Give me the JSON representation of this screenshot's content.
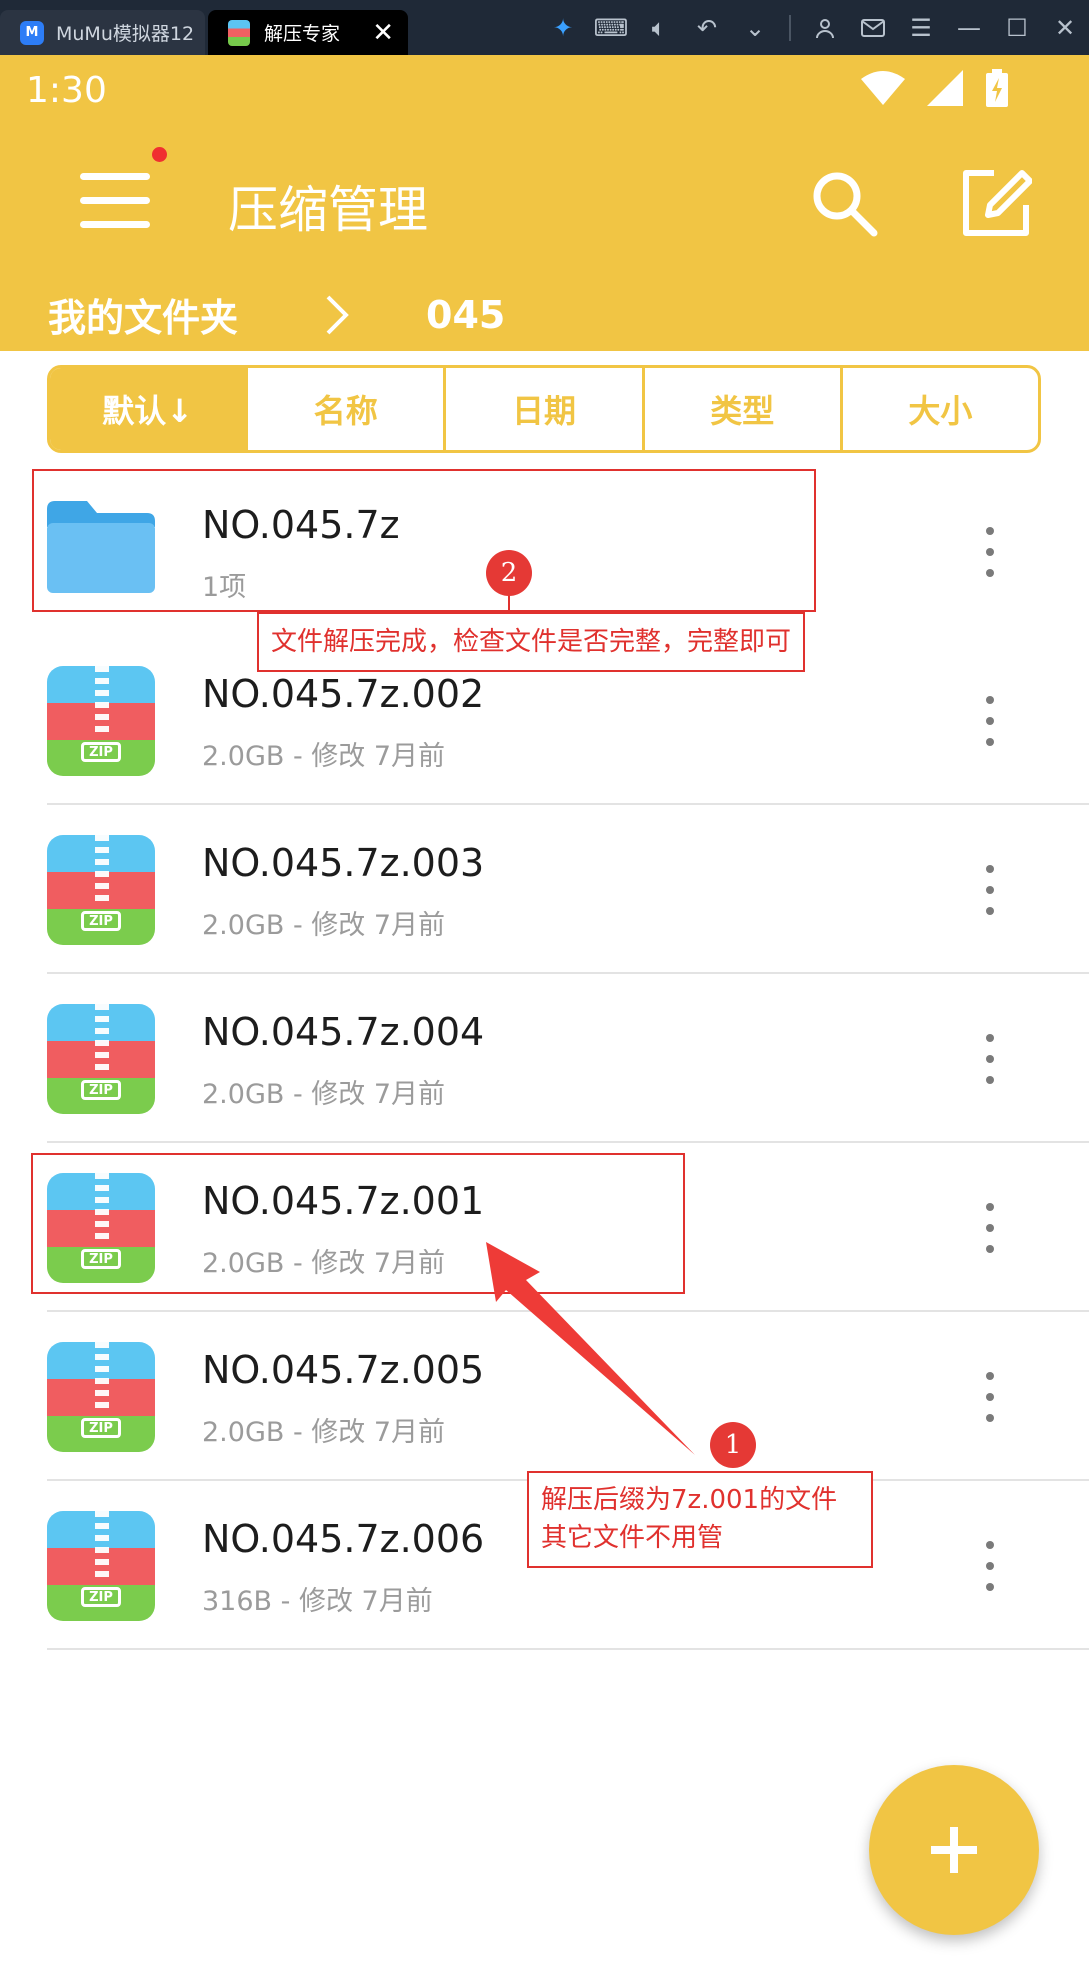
{
  "emulator": {
    "tabs": [
      {
        "label": "MuMu模拟器12"
      },
      {
        "label": "解压专家"
      }
    ],
    "mumu_logo": "M"
  },
  "status_bar": {
    "time": "1:30"
  },
  "header": {
    "title": "压缩管理",
    "breadcrumb": {
      "root": "我的文件夹",
      "current": "045"
    }
  },
  "sort_tabs": [
    "默认↓",
    "名称",
    "日期",
    "类型",
    "大小"
  ],
  "files": [
    {
      "name": "NO.045.7z",
      "meta": "1项",
      "icon": "folder-icon"
    },
    {
      "name": "NO.045.7z.002",
      "meta": "2.0GB - 修改 7月前",
      "icon": "zip-icon"
    },
    {
      "name": "NO.045.7z.003",
      "meta": "2.0GB - 修改 7月前",
      "icon": "zip-icon"
    },
    {
      "name": "NO.045.7z.004",
      "meta": "2.0GB - 修改 7月前",
      "icon": "zip-icon"
    },
    {
      "name": "NO.045.7z.001",
      "meta": "2.0GB - 修改 7月前",
      "icon": "zip-icon"
    },
    {
      "name": "NO.045.7z.005",
      "meta": "2.0GB - 修改 7月前",
      "icon": "zip-icon"
    },
    {
      "name": "NO.045.7z.006",
      "meta": "316B - 修改 7月前",
      "icon": "zip-icon"
    }
  ],
  "zip_tag": "ZIP",
  "annotations": {
    "note1": {
      "number": "1",
      "lines": [
        "解压后缀为7z.001的文件",
        "其它文件不用管"
      ]
    },
    "note2": {
      "number": "2",
      "text": "文件解压完成，检查文件是否完整，完整即可"
    }
  },
  "fab": {
    "label": "+"
  },
  "colors": {
    "accent": "#f1c544",
    "annotation": "#e0312e"
  }
}
